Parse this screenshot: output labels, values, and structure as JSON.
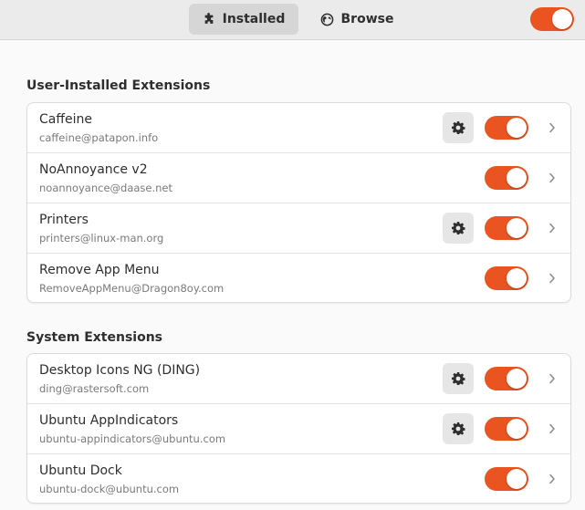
{
  "header": {
    "tabs": [
      {
        "label": "Installed",
        "icon": "puzzle-piece-icon",
        "active": true
      },
      {
        "label": "Browse",
        "icon": "globe-icon",
        "active": false
      }
    ],
    "global_toggle": {
      "on": true
    }
  },
  "sections": [
    {
      "title": "User-Installed Extensions",
      "items": [
        {
          "name": "Caffeine",
          "uuid": "caffeine@patapon.info",
          "has_settings": true,
          "enabled": true
        },
        {
          "name": "NoAnnoyance v2",
          "uuid": "noannoyance@daase.net",
          "has_settings": false,
          "enabled": true
        },
        {
          "name": "Printers",
          "uuid": "printers@linux-man.org",
          "has_settings": true,
          "enabled": true
        },
        {
          "name": "Remove App Menu",
          "uuid": "RemoveAppMenu@Dragon8oy.com",
          "has_settings": false,
          "enabled": true
        }
      ]
    },
    {
      "title": "System Extensions",
      "items": [
        {
          "name": "Desktop Icons NG (DING)",
          "uuid": "ding@rastersoft.com",
          "has_settings": true,
          "enabled": true
        },
        {
          "name": "Ubuntu AppIndicators",
          "uuid": "ubuntu-appindicators@ubuntu.com",
          "has_settings": true,
          "enabled": true
        },
        {
          "name": "Ubuntu Dock",
          "uuid": "ubuntu-dock@ubuntu.com",
          "has_settings": false,
          "enabled": true
        }
      ]
    }
  ],
  "colors": {
    "accent": "#e95420",
    "header_bg": "#ebebeb",
    "window_bg": "#fafafa",
    "card_bg": "#ffffff"
  }
}
